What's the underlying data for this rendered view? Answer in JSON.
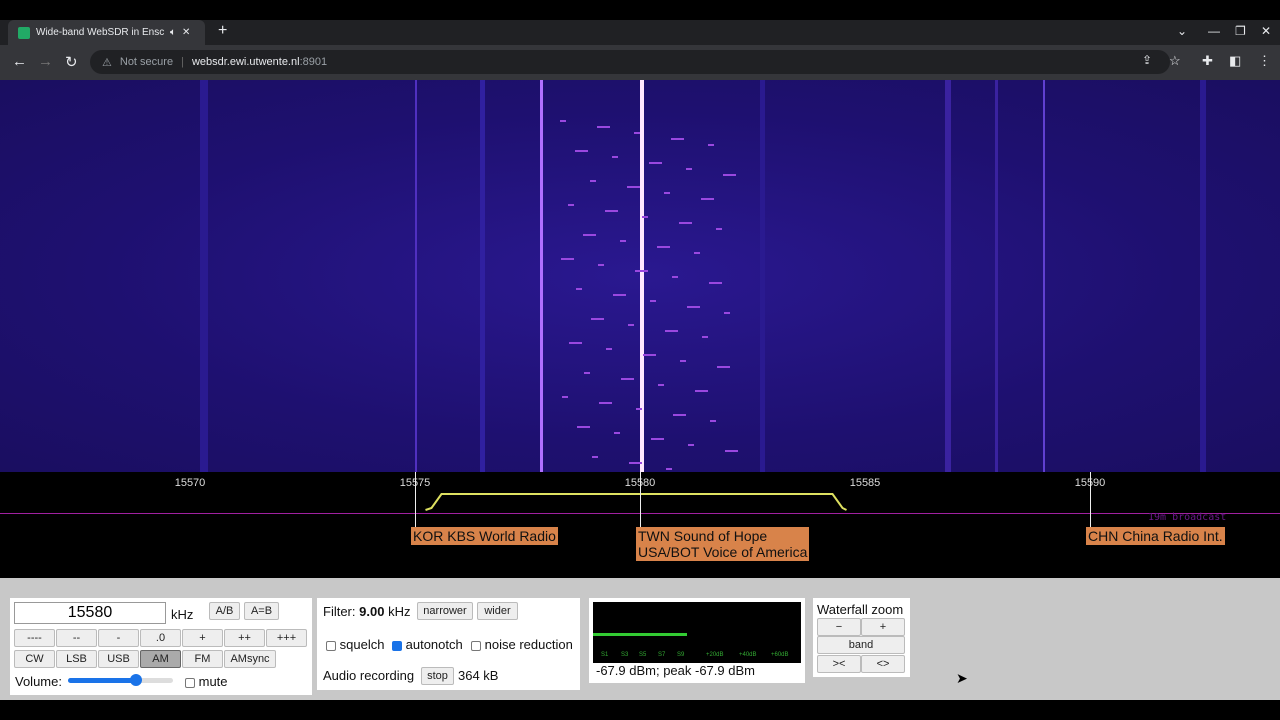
{
  "browser": {
    "tab_title": "Wide-band WebSDR in Enschede",
    "new_tab": "+",
    "url_warning": "Not secure",
    "url_host": "websdr.ewi.utwente.nl",
    "url_port": ":8901"
  },
  "scale": {
    "ticks": [
      {
        "f": 15570,
        "label": "15570"
      },
      {
        "f": 15575,
        "label": "15575"
      },
      {
        "f": 15580,
        "label": "15580"
      },
      {
        "f": 15585,
        "label": "15585"
      },
      {
        "f": 15590,
        "label": "15590"
      }
    ],
    "band_label": "19m broadcast",
    "passband_khz": [
      15575.5,
      15584.5
    ]
  },
  "stations": [
    {
      "f": 15575,
      "label": "KOR KBS World Radio"
    },
    {
      "f": 15580,
      "label": "TWN Sound of Hope\nUSA/BOT Voice of America"
    },
    {
      "f": 15590,
      "label": "CHN China Radio Int."
    }
  ],
  "tuning": {
    "frequency": "15580",
    "unit": "kHz",
    "ab": "A/B",
    "aeqb": "A=B",
    "steps": [
      "----",
      "--",
      "-",
      ".0",
      "+",
      "++",
      "+++"
    ],
    "modes": [
      "CW",
      "LSB",
      "USB",
      "AM",
      "FM",
      "AMsync"
    ],
    "active_mode": "AM",
    "volume_label": "Volume:",
    "volume": 0.66,
    "mute_label": "mute",
    "mute": false
  },
  "filter": {
    "label": "Filter:",
    "value": "9.00",
    "unit": "kHz",
    "narrower": "narrower",
    "wider": "wider",
    "squelch": "squelch",
    "autonotch": "autonotch",
    "noise_reduction": "noise reduction",
    "rec_label": "Audio recording",
    "stop": "stop",
    "size": "364 kB"
  },
  "smeter": {
    "ticks": [
      "S1",
      "S3",
      "S5",
      "S7",
      "S9",
      "+20dB",
      "+40dB",
      "+60dB"
    ],
    "reading": "-67.9 dBm; peak  -67.9 dBm"
  },
  "zoom": {
    "title": "Waterfall zoom",
    "minus": "−",
    "plus": "+",
    "band": "band",
    "narrow": "><",
    "wide": "<>"
  }
}
